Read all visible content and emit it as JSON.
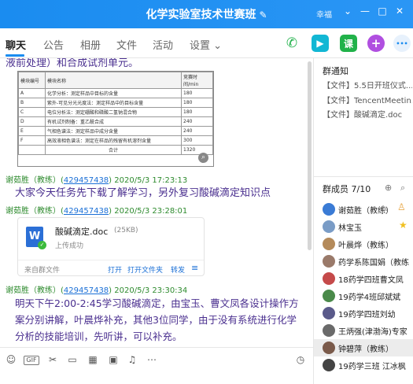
{
  "window": {
    "title": "化学实验室技术世赛班",
    "user": "幸福",
    "minimize": "⌄",
    "restore": "—",
    "maximize": "□",
    "close": "✕"
  },
  "tabs": [
    "聊天",
    "公告",
    "相册",
    "文件",
    "活动",
    "设置 ⌄"
  ],
  "top_actions": {
    "class_label": "课",
    "more_label": "•••"
  },
  "chat": {
    "partial_top_text": "液前处理）和合成试剂单元。",
    "table_image": {
      "headers": [
        "模块编号",
        "模块名称",
        "竞赛时间/min"
      ],
      "rows": [
        [
          "A",
          "化学分析：测定样品中目标的含量",
          "180"
        ],
        [
          "B",
          "紫外-可见分光光度法：测定样品中的目标含量",
          "180"
        ],
        [
          "C",
          "电位分析法：测定硼酸和磷酸二氢钠混合物",
          "180"
        ],
        [
          "D",
          "有机试剂制备：重乙酰合成",
          "240"
        ],
        [
          "E",
          "气相色谱法：测定样品中成分含量",
          "240"
        ],
        [
          "F",
          "高效液相色谱法：测定在样品的残留有机溶剂含量",
          "300"
        ],
        [
          "",
          "合计",
          "1320"
        ]
      ]
    },
    "messages": [
      {
        "sender": "谢茹胜（教练）",
        "qq": "429457438",
        "time": "2020/5/3 17:23:13",
        "text": "大家今天任务先下载了解学习，另外复习酸碱滴定知识点"
      },
      {
        "sender": "谢茹胜（教练）",
        "qq": "429457438",
        "time": "2020/5/3 23:28:01"
      },
      {
        "sender": "谢茹胜（教练）",
        "qq": "429457438",
        "time": "2020/5/3 23:30:34",
        "lines": [
          "明天下午2:00-2:45学习酸碱滴定，由宝玉、曹文凤各设计操作方",
          "案分别讲解，叶晨烨补充，其他3位同学，由于没有系统进行化学",
          "分析的技能培训，先听讲，可以补充。"
        ]
      }
    ],
    "file": {
      "name": "酸碱滴定.doc",
      "size": "(25KB)",
      "status": "上传成功",
      "source": "来自群文件",
      "open": "打开",
      "open_folder": "打开文件夹",
      "forward": "转发"
    }
  },
  "notices": {
    "title": "群通知",
    "items": [
      "【文件】5.5日开班仪式...",
      "【文件】TencentMeetin...",
      "【文件】酸碱滴定.doc"
    ]
  },
  "members": {
    "title": "群成员 7/10",
    "list": [
      {
        "name": "谢茹胜（教练）",
        "color": "#3a7bd5"
      },
      {
        "name": "林宝玉",
        "color": "#7a9cc6"
      },
      {
        "name": "叶晨烨（教练）",
        "color": "#b48a5a"
      },
      {
        "name": "药学系陈国娟（教练",
        "color": "#9a7a6a"
      },
      {
        "name": "18药学四班曹文凤",
        "color": "#c54a4a"
      },
      {
        "name": "19药学4班邱斌斌",
        "color": "#4a8a4a"
      },
      {
        "name": "19药学四班刘幼",
        "color": "#5a5a8a"
      },
      {
        "name": "王炳强(津渤海)专家",
        "color": "#6a6a6a"
      },
      {
        "name": "钟碧萍（教练）",
        "color": "#7a5a4a"
      },
      {
        "name": "19药学三班 江冰枫",
        "color": "#444"
      }
    ]
  },
  "colors": {
    "titlebar": "#1a8cf0",
    "accent": "#1a8cf0",
    "message_text": "#4a2f8f",
    "sender": "#2e8b2e"
  }
}
